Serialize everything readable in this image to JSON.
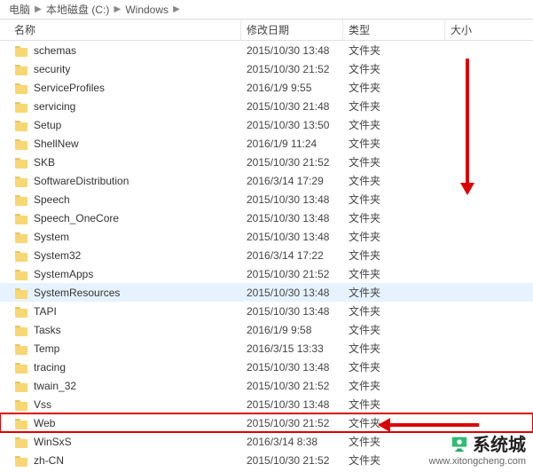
{
  "breadcrumb": {
    "parts": [
      "电脑",
      "本地磁盘 (C:)",
      "Windows"
    ]
  },
  "columns": {
    "name": "名称",
    "date": "修改日期",
    "type": "类型",
    "size": "大小"
  },
  "folder_type": "文件夹",
  "rows": [
    {
      "name": "schemas",
      "date": "2015/10/30 13:48"
    },
    {
      "name": "security",
      "date": "2015/10/30 21:52"
    },
    {
      "name": "ServiceProfiles",
      "date": "2016/1/9 9:55"
    },
    {
      "name": "servicing",
      "date": "2015/10/30 21:48"
    },
    {
      "name": "Setup",
      "date": "2015/10/30 13:50"
    },
    {
      "name": "ShellNew",
      "date": "2016/1/9 11:24"
    },
    {
      "name": "SKB",
      "date": "2015/10/30 21:52"
    },
    {
      "name": "SoftwareDistribution",
      "date": "2016/3/14 17:29"
    },
    {
      "name": "Speech",
      "date": "2015/10/30 13:48"
    },
    {
      "name": "Speech_OneCore",
      "date": "2015/10/30 13:48"
    },
    {
      "name": "System",
      "date": "2015/10/30 13:48"
    },
    {
      "name": "System32",
      "date": "2016/3/14 17:22"
    },
    {
      "name": "SystemApps",
      "date": "2015/10/30 21:52"
    },
    {
      "name": "SystemResources",
      "date": "2015/10/30 13:48",
      "hover": true
    },
    {
      "name": "TAPI",
      "date": "2015/10/30 13:48"
    },
    {
      "name": "Tasks",
      "date": "2016/1/9 9:58"
    },
    {
      "name": "Temp",
      "date": "2016/3/15 13:33"
    },
    {
      "name": "tracing",
      "date": "2015/10/30 13:48"
    },
    {
      "name": "twain_32",
      "date": "2015/10/30 21:52"
    },
    {
      "name": "Vss",
      "date": "2015/10/30 13:48"
    },
    {
      "name": "Web",
      "date": "2015/10/30 21:52",
      "marked": true
    },
    {
      "name": "WinSxS",
      "date": "2016/3/14 8:38"
    },
    {
      "name": "zh-CN",
      "date": "2015/10/30 21:52"
    }
  ],
  "watermark": {
    "cn": "系统城",
    "url": "www.xitongcheng.com"
  }
}
